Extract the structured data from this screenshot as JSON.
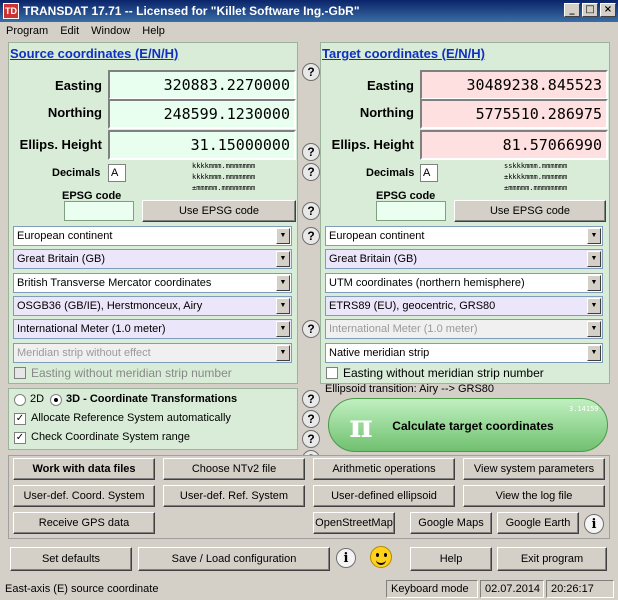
{
  "window": {
    "title": "TRANSDAT 17.71 -- Licensed for \"Killet Software Ing.-GbR\"",
    "app_icon": "TD"
  },
  "menu": [
    "Program",
    "Edit",
    "Window",
    "Help"
  ],
  "source": {
    "heading": "Source coordinates (E/N/H)",
    "fields": [
      {
        "label": "Easting",
        "value": "320883.2270000"
      },
      {
        "label": "Northing",
        "value": "248599.1230000"
      },
      {
        "label": "Ellips. Height",
        "value": "31.15000000"
      }
    ],
    "decimals_label": "Decimals",
    "decimals_value": "A",
    "format_lines": [
      "kkkkmmm.mmmmmmm",
      "kkkkmmm.mmmmmmm",
      "±mmmmm.mmmmmmmm"
    ],
    "epsg_label": "EPSG code",
    "epsg_value": "",
    "use_epsg_label": "Use EPSG code",
    "dropdowns": [
      "European continent",
      "Great Britain (GB)",
      "British Transverse Mercator coordinates",
      "OSGB36 (GB/IE), Herstmonceux, Airy",
      "International Meter (1.0 meter)",
      "Meridian strip without effect"
    ],
    "easting_checkbox_label": "Easting without meridian strip number"
  },
  "target": {
    "heading": "Target coordinates (E/N/H)",
    "fields": [
      {
        "label": "Easting",
        "value": "30489238.845523"
      },
      {
        "label": "Northing",
        "value": "5775510.286975"
      },
      {
        "label": "Ellips. Height",
        "value": "81.57066990"
      }
    ],
    "decimals_label": "Decimals",
    "decimals_value": "A",
    "format_lines": [
      "sskkkmmm.mmmmmm",
      "±kkkkmmm.mmmmmm",
      "±mmmmm.mmmmmmmm"
    ],
    "epsg_label": "EPSG code",
    "epsg_value": "",
    "use_epsg_label": "Use EPSG code",
    "dropdowns": [
      "European continent",
      "Great Britain (GB)",
      "UTM coordinates (northern hemisphere)",
      "ETRS89 (EU), geocentric, GRS80",
      "International Meter (1.0 meter)",
      "Native meridian strip"
    ],
    "easting_checkbox_label": "Easting without meridian strip number"
  },
  "options": {
    "radio_2d": "2D",
    "radio_3d": "3D - Coordinate Transformations",
    "allocate_label": "Allocate Reference System automatically",
    "check_range_label": "Check Coordinate System range"
  },
  "ellipsoid_transition": "Ellipsoid transition: Airy --> GRS80",
  "calculate_label": "Calculate target coordinates",
  "calc_digits": "3.14159265358979323846264338327950288419716939937510",
  "help_glyph": "?",
  "info_glyph": "i",
  "buttons": {
    "work_with_data_files": "Work with data files",
    "choose_ntv2": "Choose NTv2 file",
    "arithmetic": "Arithmetic operations",
    "view_params": "View system parameters",
    "user_coord": "User-def. Coord. System",
    "user_ref": "User-def. Ref. System",
    "user_ellipsoid": "User-defined ellipsoid",
    "view_log": "View the log file",
    "receive_gps": "Receive GPS data",
    "osm": "OpenStreetMap",
    "google_maps": "Google Maps",
    "google_earth": "Google Earth",
    "set_defaults": "Set defaults",
    "save_load": "Save / Load configuration",
    "help": "Help",
    "exit": "Exit program"
  },
  "status": {
    "hint": "East-axis (E) source coordinate",
    "mode": "Keyboard mode",
    "date": "02.07.2014",
    "time": "20:26:17"
  },
  "colors": {
    "heading": "#1030c0",
    "panel": "#d8ecd8",
    "target_field": "#ffe0e0",
    "source_field": "#e8fff0"
  }
}
